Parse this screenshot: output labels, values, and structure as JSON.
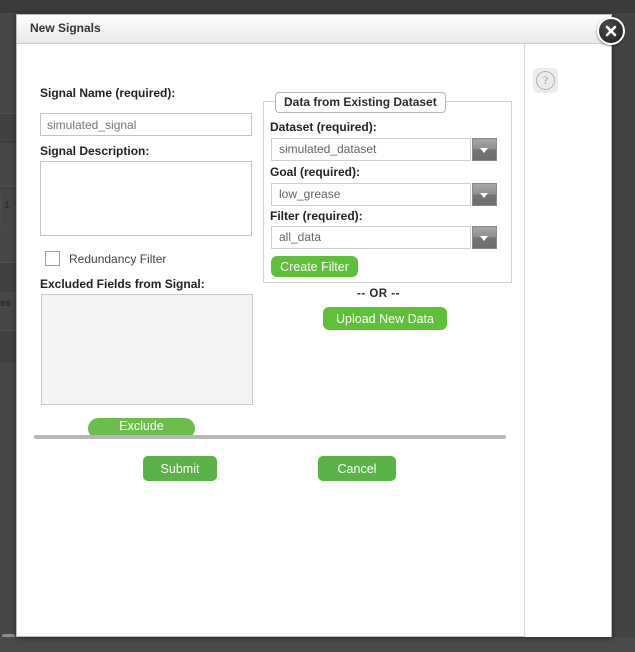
{
  "window": {
    "title": "New Signals",
    "close_icon": "close-x-icon",
    "help_icon": "question-mark-icon"
  },
  "left_panel": {
    "signal_name": {
      "label": "Signal Name (required):",
      "value": "simulated_signal",
      "placeholder": "simulated_signal"
    },
    "signal_description": {
      "label": "Signal Description:",
      "value": "",
      "placeholder": ""
    },
    "redundancy_filter": {
      "label": "Redundancy Filter",
      "checked": false
    },
    "excluded_fields": {
      "label": "Excluded Fields from Signal:",
      "items": []
    },
    "exclude_features_button": "Exclude Features"
  },
  "dataset_panel": {
    "legend": "Data from Existing Dataset",
    "fields": [
      {
        "label": "Dataset (required):",
        "value": "simulated_dataset",
        "icon": "chevron-down-icon"
      },
      {
        "label": "Goal (required):",
        "value": "low_grease",
        "icon": "chevron-down-icon"
      },
      {
        "label": "Filter (required):",
        "value": "all_data",
        "icon": "chevron-down-icon"
      }
    ],
    "create_filter_button": "Create Filter"
  },
  "upload_section": {
    "or_text": "-- OR --",
    "upload_button": "Upload New Data"
  },
  "footer": {
    "submit_button": "Submit",
    "cancel_button": "Cancel"
  },
  "backdrop": {
    "ghost_label_1": "es",
    "ghost_label_2": "1"
  },
  "colors": {
    "green_primary": "#59b347",
    "green_pill": "#6cbe4a",
    "green_bright": "#5cc136",
    "titlebar": "#f2f2f2",
    "backdrop": "#434343"
  }
}
